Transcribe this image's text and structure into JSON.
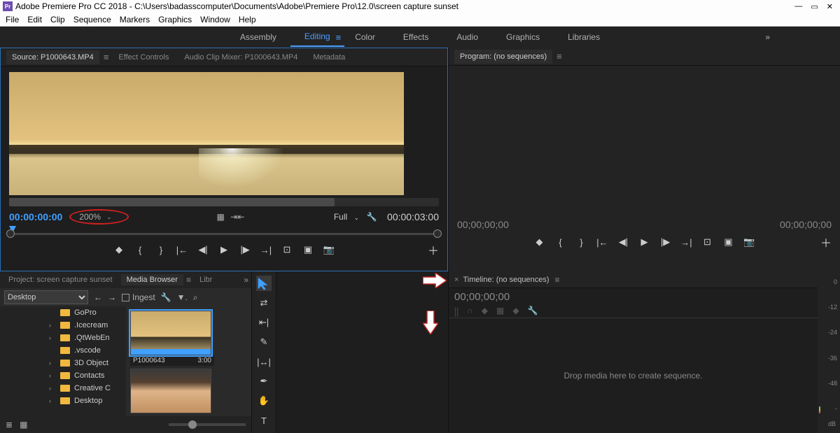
{
  "titlebar": {
    "logo_text": "Pr",
    "title": "Adobe Premiere Pro CC 2018 - C:\\Users\\badasscomputer\\Documents\\Adobe\\Premiere Pro\\12.0\\screen capture sunset",
    "minimize": "—",
    "maximize": "▭",
    "close": "✕"
  },
  "menubar": {
    "items": [
      "File",
      "Edit",
      "Clip",
      "Sequence",
      "Markers",
      "Graphics",
      "Window",
      "Help"
    ]
  },
  "workspaces": {
    "items": [
      "Assembly",
      "Editing",
      "Color",
      "Effects",
      "Audio",
      "Graphics",
      "Libraries"
    ],
    "active_index": 1,
    "overflow": "»"
  },
  "source_panel": {
    "tabs": {
      "source": "Source: P1000643.MP4",
      "effect_controls": "Effect Controls",
      "audio_mixer": "Audio Clip Mixer: P1000643.MP4",
      "metadata": "Metadata"
    },
    "tc_in": "00:00:00:00",
    "zoom": "200%",
    "fit": "Full",
    "tc_out": "00:00:03:00"
  },
  "program_panel": {
    "title": "Program: (no sequences)",
    "tc_left": "00;00;00;00",
    "tc_right": "00;00;00;00"
  },
  "project_panel": {
    "tabs": {
      "project": "Project: screen capture sunset",
      "media_browser": "Media Browser",
      "libraries": "Libr"
    },
    "dropdown": "Desktop",
    "ingest": "Ingest",
    "folders": [
      "GoPro",
      ".Icecream",
      ".QtWebEn",
      ".vscode",
      "3D Object",
      "Contacts",
      "Creative C",
      "Desktop"
    ],
    "clip": {
      "name": "P1000643",
      "duration": "3:00"
    }
  },
  "timeline": {
    "tab": "Timeline: (no sequences)",
    "tc": "00;00;00;00",
    "placeholder": "Drop media here to create sequence."
  },
  "meters": {
    "ticks": [
      "0",
      "-12",
      "-24",
      "-36",
      "-48",
      "-"
    ],
    "unit": "dB"
  }
}
